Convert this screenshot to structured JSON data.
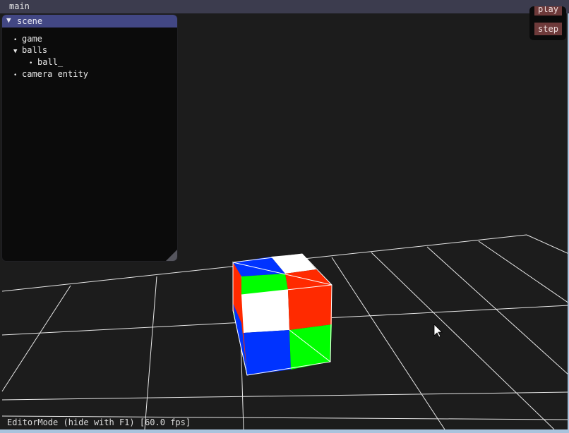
{
  "window": {
    "title": "main"
  },
  "scene_panel": {
    "title": "scene",
    "tree": [
      {
        "label": "game",
        "kind": "leaf"
      },
      {
        "label": "balls",
        "kind": "expanded"
      },
      {
        "label": "ball_",
        "kind": "leaf"
      },
      {
        "label": "camera entity",
        "kind": "leaf"
      }
    ]
  },
  "controls": {
    "play_label": "play",
    "step_label": "step"
  },
  "status": {
    "text": "EditorMode (hide with F1) [60.0 fps]"
  },
  "colors": {
    "background": "#1c1c1c",
    "grid": "#e8e8e8",
    "cube_red": "#ff2a00",
    "cube_green": "#00ff00",
    "cube_blue": "#0033ff",
    "cube_white": "#ffffff",
    "panel_header": "#424784",
    "button": "#6e3a3a"
  }
}
